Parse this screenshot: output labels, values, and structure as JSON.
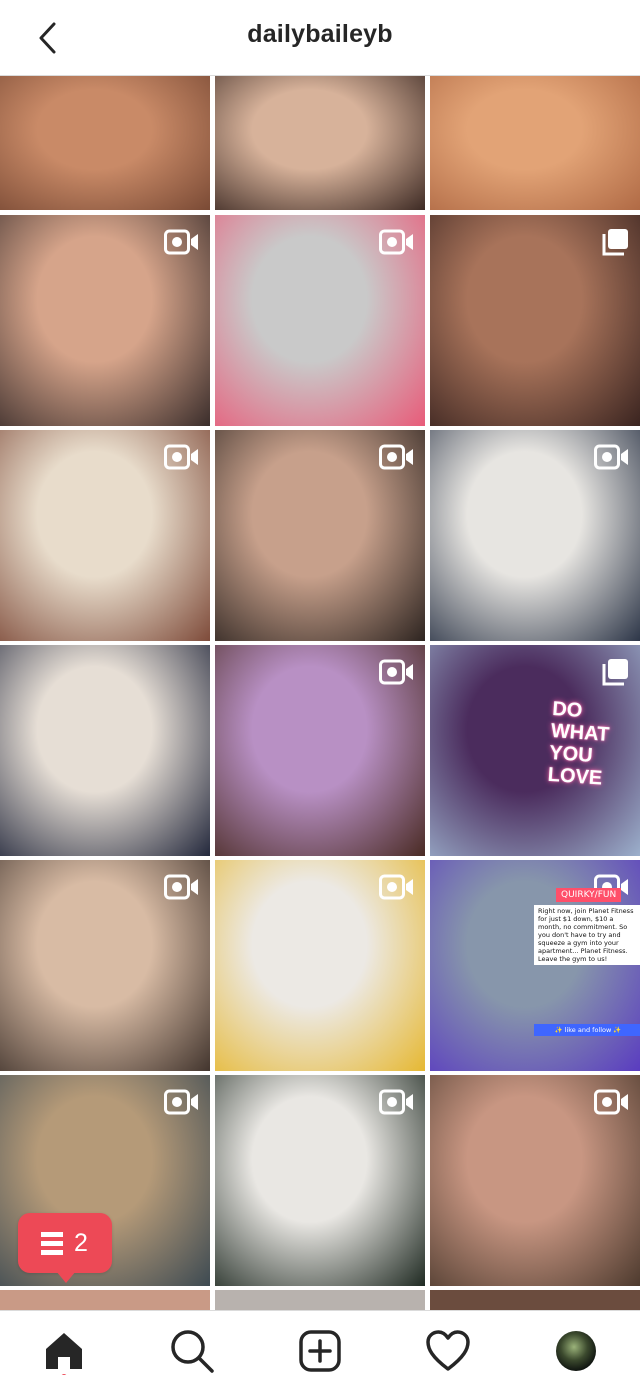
{
  "header": {
    "username": "dailybaileyb"
  },
  "notification": {
    "count": "2"
  },
  "grid": {
    "tiles": [
      {
        "name": "post-eyeshadow-closeup",
        "type": "image",
        "colors": [
          "#c98a67",
          "#7a4a35"
        ]
      },
      {
        "name": "post-smiling-portrait",
        "type": "image",
        "colors": [
          "#d7b29a",
          "#3d2a24"
        ]
      },
      {
        "name": "post-eye-profile",
        "type": "image",
        "colors": [
          "#e2a376",
          "#b06a45"
        ]
      },
      {
        "name": "post-green-eyeshadow-application",
        "type": "video",
        "colors": [
          "#d6a48a",
          "#3a2d2b"
        ]
      },
      {
        "name": "post-pens-cup-face",
        "type": "video",
        "colors": [
          "#c9c9c9",
          "#e85b79"
        ]
      },
      {
        "name": "post-green-eyeshadow-portrait",
        "type": "carousel",
        "colors": [
          "#a8735a",
          "#3a2420"
        ]
      },
      {
        "name": "post-brushes-face",
        "type": "video",
        "colors": [
          "#e8dccb",
          "#7e4b3a"
        ]
      },
      {
        "name": "post-neon-liner",
        "type": "video",
        "colors": [
          "#c7a08b",
          "#2d2420"
        ]
      },
      {
        "name": "post-dress-mirror-selfie",
        "type": "video",
        "colors": [
          "#e7e5e1",
          "#2d3648"
        ]
      },
      {
        "name": "post-yellow-nails",
        "type": "image",
        "colors": [
          "#e6ded5",
          "#23283c"
        ]
      },
      {
        "name": "post-hair-tutorial",
        "type": "video",
        "colors": [
          "#b890c4",
          "#4a2b24"
        ]
      },
      {
        "name": "post-sequin-jacket",
        "type": "carousel",
        "colors": [
          "#4b2c5d",
          "#9cb0cc"
        ]
      },
      {
        "name": "post-jeweled-headband",
        "type": "video",
        "colors": [
          "#d8bba4",
          "#42352e"
        ]
      },
      {
        "name": "post-yellow-skirt",
        "type": "video",
        "colors": [
          "#ece9e4",
          "#e6b832"
        ]
      },
      {
        "name": "post-planet-fitness",
        "type": "video",
        "colors": [
          "#8796ab",
          "#5a3cc0"
        ]
      },
      {
        "name": "post-glitter-pots",
        "type": "video",
        "colors": [
          "#b59a78",
          "#3d4a52"
        ]
      },
      {
        "name": "post-green-dress",
        "type": "video",
        "colors": [
          "#e9e7e3",
          "#1f2a22"
        ]
      },
      {
        "name": "post-lashes-closeup",
        "type": "video",
        "colors": [
          "#c89682",
          "#4d3a2e"
        ]
      }
    ],
    "tiktok_overlay": {
      "tag": "QUIRKY/FUN",
      "text": "Right now, join Planet Fitness for just $1 down, $10 a month, no commitment. So you don't have to try and squeeze a gym into your apartment... Planet Fitness. Leave the gym to us!",
      "cta": "✨ like and follow ✨"
    },
    "neon_sign": "DO WHAT YOU LOVE"
  },
  "nav": {
    "items": [
      "home-icon",
      "search-icon",
      "new-post-icon",
      "activity-heart-icon",
      "profile-avatar"
    ]
  },
  "colors": {
    "accent": "#ed4956",
    "text": "#262626",
    "divider": "#dbdbdb"
  }
}
